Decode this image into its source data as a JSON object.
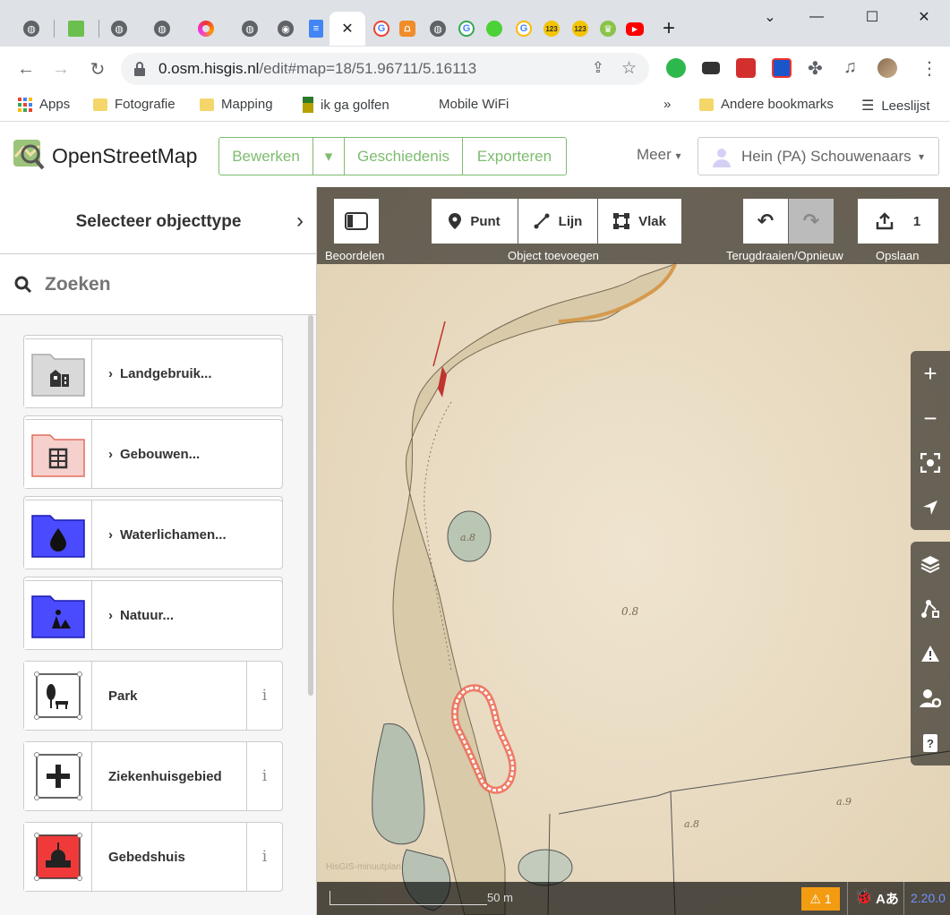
{
  "browser": {
    "url_host": "0.osm.hisgis.nl",
    "url_path": "/edit#map=18/51.96711/5.16113",
    "active_tab_close": "✕"
  },
  "bookmarks": [
    {
      "label": "Apps",
      "icon": "apps-grid-icon"
    },
    {
      "label": "Fotografie",
      "icon": "folder-icon"
    },
    {
      "label": "Mapping",
      "icon": "folder-icon"
    },
    {
      "label": "ik ga golfen",
      "icon": "golf-icon"
    },
    {
      "label": "Mobile WiFi",
      "icon": "none"
    },
    {
      "label": "»",
      "icon": "none"
    },
    {
      "label": "Andere bookmarks",
      "icon": "folder-icon"
    },
    {
      "label": "Leeslijst",
      "icon": "reading-list-icon"
    }
  ],
  "osm": {
    "title": "OpenStreetMap",
    "edit_label": "Bewerken",
    "history_label": "Geschiedenis",
    "export_label": "Exporteren",
    "more_label": "Meer",
    "user_name": "Hein (PA) Schouwenaars"
  },
  "sidebar": {
    "header": "Selecteer objecttype",
    "search_placeholder": "Zoeken",
    "presets": [
      {
        "label": "Landgebruik...",
        "type": "category",
        "color": "#d9d9d9",
        "border": "#aaaaaa"
      },
      {
        "label": "Gebouwen...",
        "type": "category",
        "color": "#f6d0cc",
        "border": "#e06e5f"
      },
      {
        "label": "Waterlichamen...",
        "type": "category",
        "color": "#4a4aff",
        "border": "#1a1ab0"
      },
      {
        "label": "Natuur...",
        "type": "category",
        "color": "#4a4aff",
        "border": "#1a1ab0"
      },
      {
        "label": "Park",
        "type": "area",
        "info": "i"
      },
      {
        "label": "Ziekenhuisgebied",
        "type": "area",
        "info": "i"
      },
      {
        "label": "Gebedshuis",
        "type": "area",
        "info": "i"
      }
    ]
  },
  "toolbar": {
    "review_label": "Beoordelen",
    "point_label": "Punt",
    "line_label": "Lijn",
    "area_label": "Vlak",
    "add_group_label": "Object toevoegen",
    "undo_redo_label": "Terugdraaien/Opnieuw",
    "save_count": "1",
    "save_label": "Opslaan"
  },
  "footer": {
    "scale_label": "50 m",
    "imagery_attribution": "HisGIS-minuutplan",
    "issues_count": "1",
    "version": "2.20.0"
  }
}
